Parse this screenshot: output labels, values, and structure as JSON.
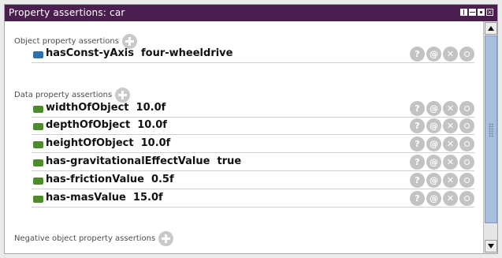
{
  "window": {
    "title": "Property assertions: car",
    "controls": [
      "split-view-icon",
      "hsplit-view-icon",
      "maximize-icon",
      "close-icon"
    ]
  },
  "colors": {
    "title_bar": "#4a1f4f",
    "object_property_swatch": "#2f6cb0",
    "data_property_swatch": "#4f8a2e",
    "action_icon": "#c3c3c3",
    "scroll_thumb": "#a8c0dc"
  },
  "sections": {
    "object": {
      "header": "Object property assertions",
      "rows": [
        {
          "label": "hasConst-yAxis  four-wheeldrive"
        }
      ]
    },
    "data": {
      "header": "Data property assertions",
      "rows": [
        {
          "label": "widthOfObject  10.0f"
        },
        {
          "label": "depthOfObject  10.0f"
        },
        {
          "label": "heightOfObject  10.0f"
        },
        {
          "label": "has-gravitationalEffectValue  true"
        },
        {
          "label": "has-frictionValue  0.5f"
        },
        {
          "label": "has-masValue  15.0f"
        }
      ]
    },
    "negative_object": {
      "header": "Negative object property assertions"
    }
  },
  "actions": {
    "explain": "?",
    "annotate": "@"
  }
}
